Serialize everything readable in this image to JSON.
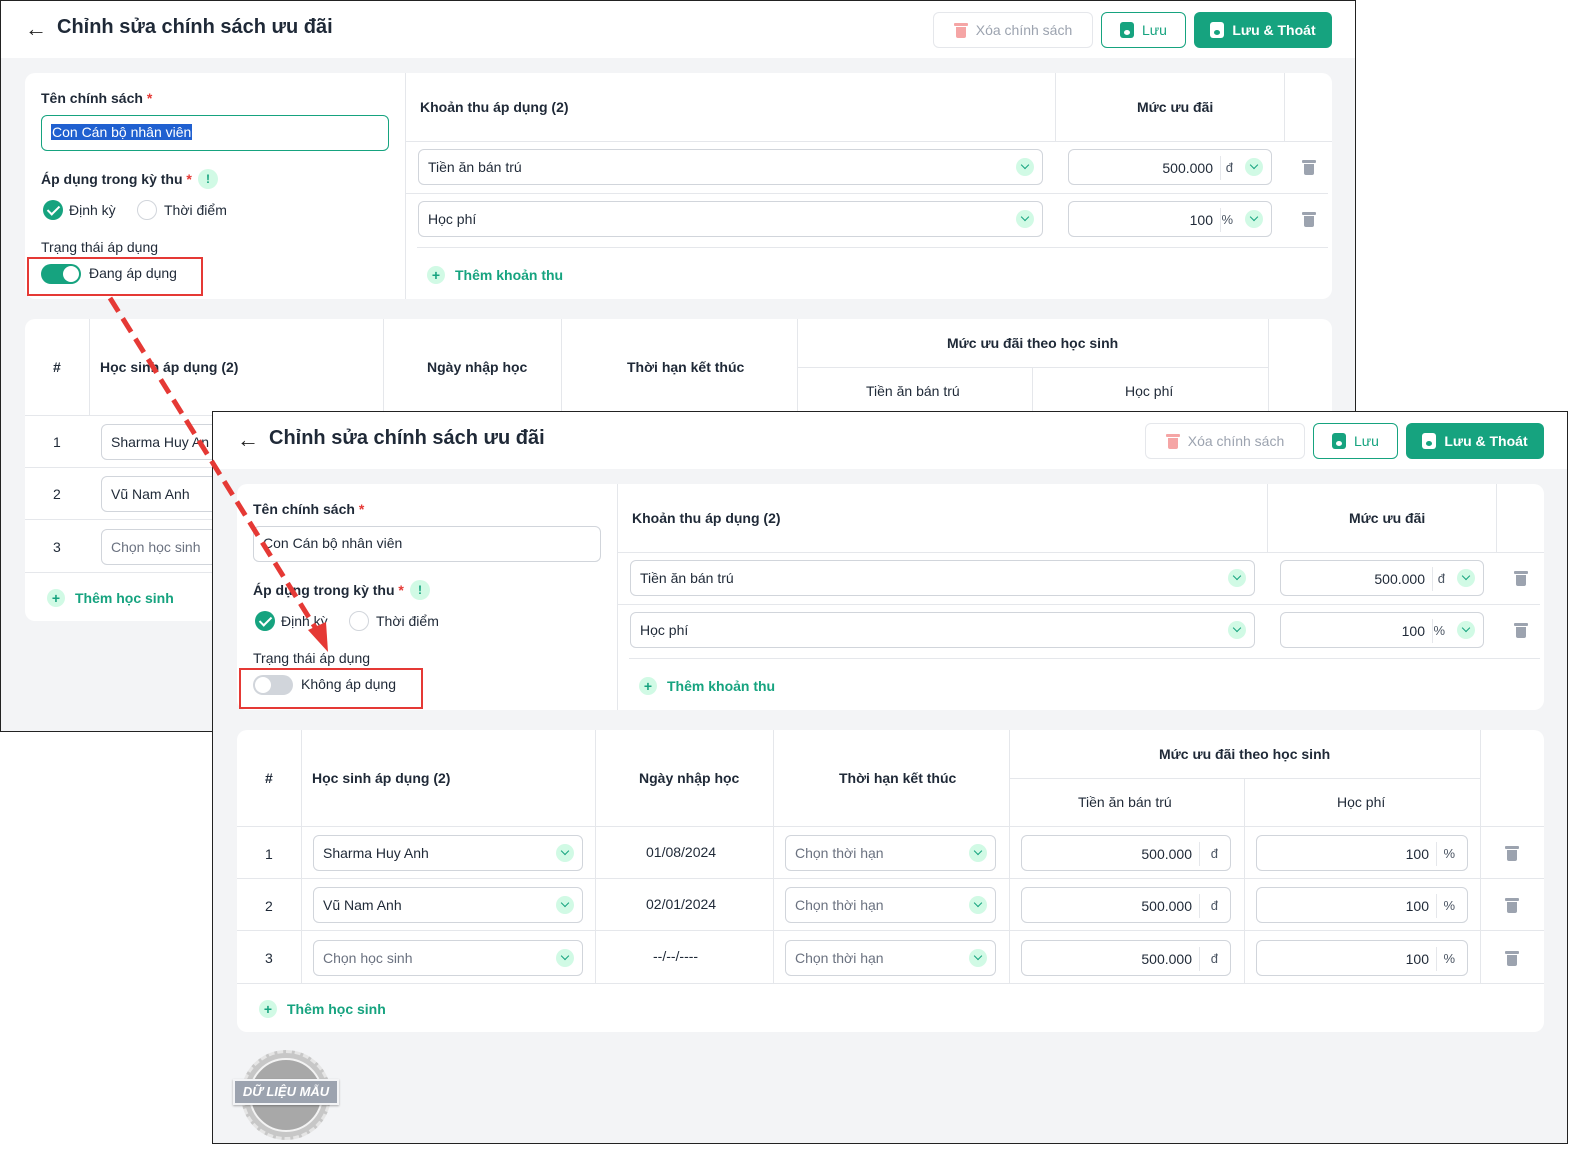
{
  "page": {
    "title": "Chỉnh sửa chính sách ưu đãi",
    "delete_label": "Xóa chính sách",
    "save_label": "Lưu",
    "save_exit_label": "Lưu & Thoát"
  },
  "form": {
    "name_label": "Tên chính sách",
    "required_mark": "*",
    "name_value": "Con Cán bộ nhân viên",
    "period_label": "Áp dụng trong kỳ thu",
    "info_glyph": "!",
    "radio_periodic": "Định kỳ",
    "radio_point": "Thời điểm",
    "status_label": "Trạng thái áp dụng",
    "status_on": "Đang áp dụng",
    "status_off": "Không áp dụng"
  },
  "fees": {
    "col_fee": "Khoản thu áp dụng (2)",
    "col_discount": "Mức ưu đãi",
    "rows": [
      {
        "fee": "Tiền ăn bán trú",
        "value": "500.000",
        "unit": "đ"
      },
      {
        "fee": "Học phí",
        "value": "100",
        "unit": "%"
      }
    ],
    "add_label": "Thêm khoản thu"
  },
  "students": {
    "col_index": "#",
    "col_student": "Học sinh áp dụng (2)",
    "col_enroll": "Ngày nhập học",
    "col_end": "Thời hạn kết thúc",
    "col_group": "Mức ưu đãi theo học sinh",
    "col_sub1": "Tiền ăn bán trú",
    "col_sub2": "Học phí",
    "rows": [
      {
        "index": "1",
        "student": "Sharma Huy Anh",
        "enroll": "01/08/2024",
        "end": "Chọn thời hạn",
        "v1": "500.000",
        "u1": "đ",
        "v2": "100",
        "u2": "%"
      },
      {
        "index": "2",
        "student": "Vũ Nam Anh",
        "enroll": "02/01/2024",
        "end": "Chọn thời hạn",
        "v1": "500.000",
        "u1": "đ",
        "v2": "100",
        "u2": "%"
      },
      {
        "index": "3",
        "student": "Chọn học sinh",
        "enroll": "--/--/----",
        "end": "Chọn thời hạn",
        "v1": "500.000",
        "u1": "đ",
        "v2": "100",
        "u2": "%"
      }
    ],
    "back_student_partial": [
      "Sharma Huy An",
      "Vũ Nam Anh",
      "Chọn học sinh"
    ],
    "add_label": "Thêm học sinh"
  },
  "stamp_text": "DỮ LIỆU MẪU",
  "colors": {
    "accent": "#16a37f",
    "highlight_box": "#e53935",
    "arrow": "#e53935"
  }
}
